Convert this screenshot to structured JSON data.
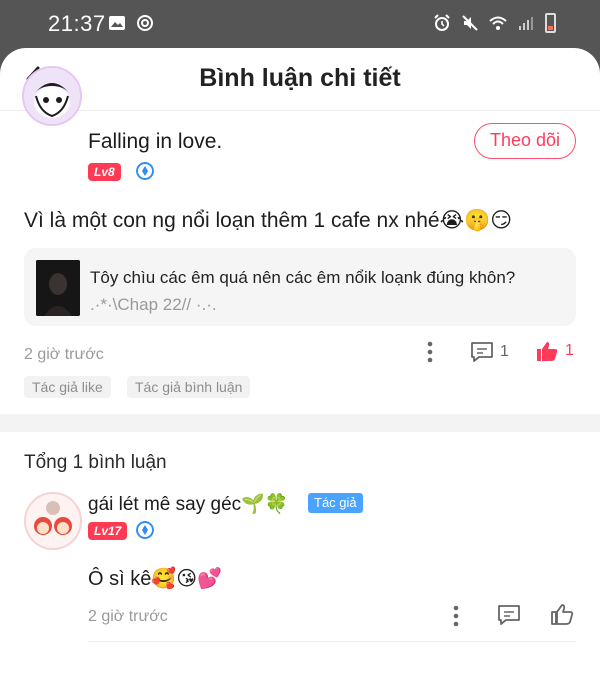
{
  "status_bar": {
    "time": "21:37",
    "icons": [
      "image-icon",
      "sync-icon",
      "alarm-icon",
      "mute-icon",
      "wifi-icon",
      "signal-icon",
      "battery-icon"
    ]
  },
  "header": {
    "title": "Bình luận chi tiết",
    "back_icon": "chevron-left-icon"
  },
  "main_comment": {
    "user_name": "Falling in love.",
    "level": "Lv8",
    "follow_label": "Theo dõi",
    "text": "Vì là một con ng nổi loạn thêm 1 cafe nx nhé😭🤫😏",
    "quote": {
      "text": "Tôy chìu các êm quá nên các êm nổik loạnk đúng khôn?",
      "chapter": ".·*·\\Chap 22// ·.·."
    },
    "time": "2 giờ trước",
    "reply_count": "1",
    "like_count": "1",
    "tags": [
      "Tác giả like",
      "Tác giả bình luận"
    ]
  },
  "replies_section": {
    "total_label": "Tổng 1 bình luận",
    "reply": {
      "user_name": "gái lét mê say géc🌱🍀",
      "author_badge": "Tác giả",
      "level": "Lv17",
      "text": "Ô sì kê🥰😘💕",
      "time": "2 giờ trước"
    }
  },
  "colors": {
    "accent_pink": "#ff3b5c",
    "like_active": "#ff3b5c",
    "author_badge_blue": "#4aa3ff",
    "verified_blue": "#2c8df4",
    "meta_gray": "#9a9a9a"
  }
}
